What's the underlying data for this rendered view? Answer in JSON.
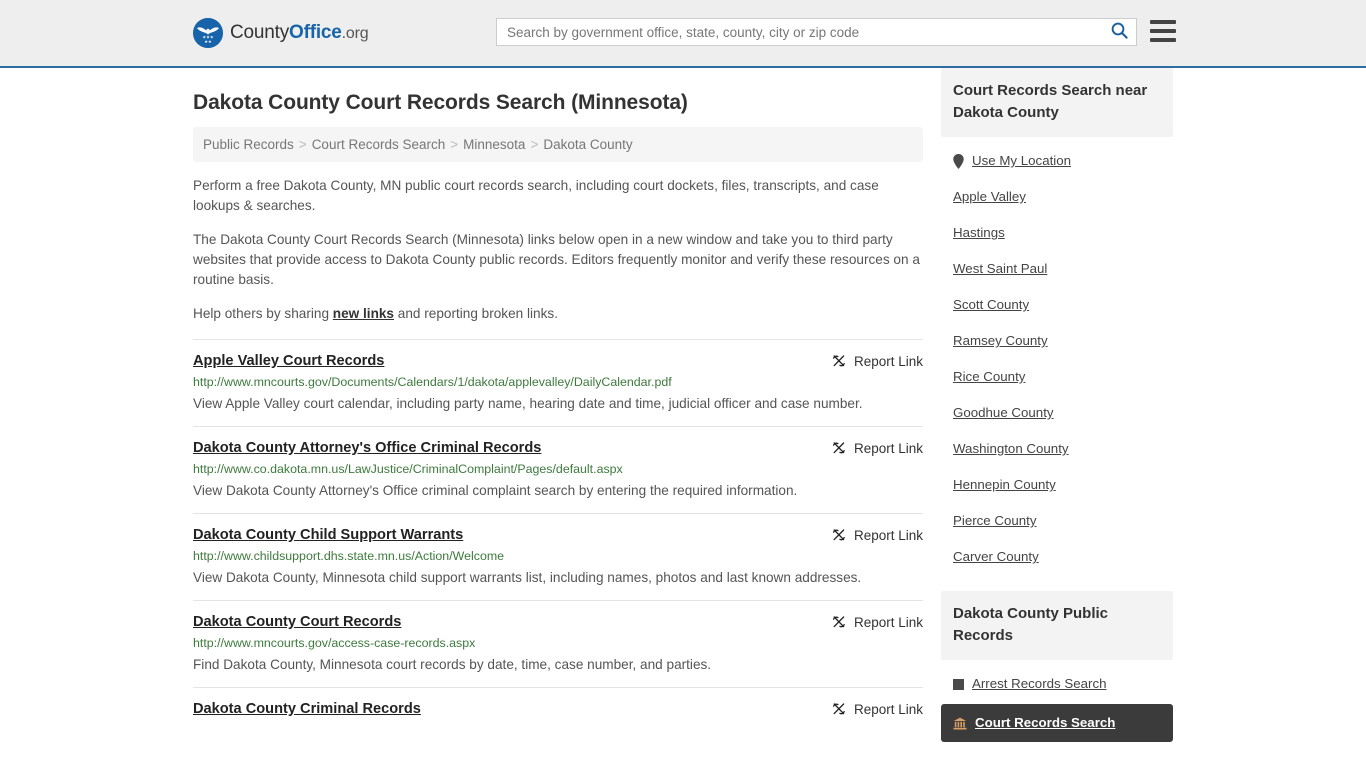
{
  "header": {
    "brand": {
      "part1": "County",
      "part2": "Office",
      "part3": ".org",
      "logo_icon": "eagle-seal-icon"
    },
    "search": {
      "placeholder": "Search by government office, state, county, city or zip code",
      "value": "",
      "icon": "search-icon"
    },
    "menu_icon": "hamburger-menu-icon"
  },
  "main": {
    "title": "Dakota County Court Records Search (Minnesota)",
    "breadcrumb": [
      {
        "label": "Public Records"
      },
      {
        "label": "Court Records Search"
      },
      {
        "label": "Minnesota"
      },
      {
        "label": "Dakota County"
      }
    ],
    "breadcrumb_separator": ">",
    "intro": {
      "p1": "Perform a free Dakota County, MN public court records search, including court dockets, files, transcripts, and case lookups & searches.",
      "p2": "The Dakota County Court Records Search (Minnesota) links below open in a new window and take you to third party websites that provide access to Dakota County public records. Editors frequently monitor and verify these resources on a routine basis.",
      "p3_before": "Help others by sharing ",
      "p3_link": "new links",
      "p3_after": " and reporting broken links."
    },
    "report_link_label": "Report Link",
    "report_link_icon": "unlink-icon",
    "results": [
      {
        "title": "Apple Valley Court Records",
        "url": "http://www.mncourts.gov/Documents/Calendars/1/dakota/applevalley/DailyCalendar.pdf",
        "description": "View Apple Valley court calendar, including party name, hearing date and time, judicial officer and case number."
      },
      {
        "title": "Dakota County Attorney's Office Criminal Records",
        "url": "http://www.co.dakota.mn.us/LawJustice/CriminalComplaint/Pages/default.aspx",
        "description": "View Dakota County Attorney's Office criminal complaint search by entering the required information."
      },
      {
        "title": "Dakota County Child Support Warrants",
        "url": "http://www.childsupport.dhs.state.mn.us/Action/Welcome",
        "description": "View Dakota County, Minnesota child support warrants list, including names, photos and last known addresses."
      },
      {
        "title": "Dakota County Court Records",
        "url": "http://www.mncourts.gov/access-case-records.aspx",
        "description": "Find Dakota County, Minnesota court records by date, time, case number, and parties."
      },
      {
        "title": "Dakota County Criminal Records",
        "url": "",
        "description": ""
      }
    ]
  },
  "sidebar": {
    "nearby": {
      "heading": "Court Records Search near Dakota County",
      "items": [
        {
          "label": "Use My Location",
          "icon": "map-pin-icon"
        },
        {
          "label": "Apple Valley",
          "icon": ""
        },
        {
          "label": "Hastings",
          "icon": ""
        },
        {
          "label": "West Saint Paul",
          "icon": ""
        },
        {
          "label": "Scott County",
          "icon": ""
        },
        {
          "label": "Ramsey County",
          "icon": ""
        },
        {
          "label": "Rice County",
          "icon": ""
        },
        {
          "label": "Goodhue County",
          "icon": ""
        },
        {
          "label": "Washington County",
          "icon": ""
        },
        {
          "label": "Hennepin County",
          "icon": ""
        },
        {
          "label": "Pierce County",
          "icon": ""
        },
        {
          "label": "Carver County",
          "icon": ""
        }
      ]
    },
    "public_records": {
      "heading": "Dakota County Public Records",
      "items": [
        {
          "label": "Arrest Records Search",
          "icon": "handcuffs-icon",
          "active": false
        },
        {
          "label": "Court Records Search",
          "icon": "courthouse-icon",
          "active": true
        }
      ]
    }
  },
  "colors": {
    "brand_blue": "#1864ab",
    "header_bg": "#eeeeee",
    "header_border": "#2e6da4",
    "url_green": "#3d7a3d",
    "active_bg": "#3b3b3b",
    "accent_orange": "#d9a066"
  }
}
